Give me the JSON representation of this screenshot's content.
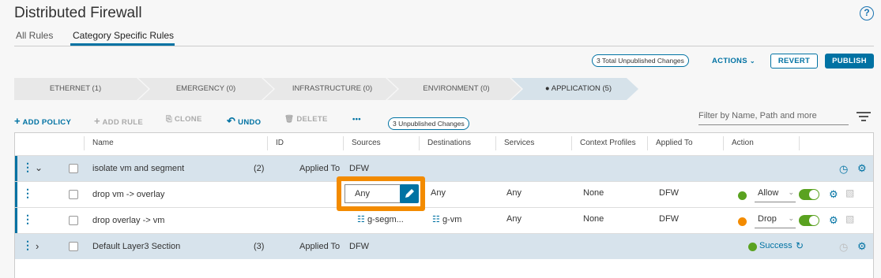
{
  "header": {
    "title": "Distributed Firewall",
    "help": "?"
  },
  "tabs": [
    {
      "label": "All Rules"
    },
    {
      "label": "Category Specific Rules"
    }
  ],
  "topbar": {
    "unpublished_total": "3 Total Unpublished Changes",
    "actions": "ACTIONS",
    "revert": "REVERT",
    "publish": "PUBLISH"
  },
  "categories": [
    {
      "label": "ETHERNET (1)"
    },
    {
      "label": "EMERGENCY (0)"
    },
    {
      "label": "INFRASTRUCTURE (0)"
    },
    {
      "label": "ENVIRONMENT (0)"
    },
    {
      "label": "APPLICATION (5)"
    }
  ],
  "toolbar": {
    "add_policy": "ADD POLICY",
    "add_rule": "ADD RULE",
    "clone": "CLONE",
    "undo": "UNDO",
    "delete": "DELETE",
    "more": "•••",
    "unpublished": "3 Unpublished Changes",
    "filter_placeholder": "Filter by Name, Path and more"
  },
  "columns": [
    "Name",
    "ID",
    "Sources",
    "Destinations",
    "Services",
    "Context Profiles",
    "Applied To",
    "Action"
  ],
  "rows": [
    {
      "name": "isolate vm and segment",
      "count": "(2)",
      "applied_label": "Applied To",
      "applied": "DFW"
    },
    {
      "name": "drop vm -> overlay",
      "source": "Any",
      "destination": "Any",
      "service": "Any",
      "context": "None",
      "applied": "DFW",
      "action": "Allow"
    },
    {
      "name": "drop overlay -> vm",
      "source": "g-segm...",
      "destination": "g-vm",
      "service": "Any",
      "context": "None",
      "applied": "DFW",
      "action": "Drop"
    },
    {
      "name": "Default Layer3 Section",
      "count": "(3)",
      "applied_label": "Applied To",
      "applied": "DFW",
      "status": "Success"
    }
  ],
  "colors": {
    "accent": "#0072a3",
    "highlight": "#f38b00",
    "allow": "#5aa220",
    "drop": "#f38b00",
    "success": "#5aa220"
  }
}
